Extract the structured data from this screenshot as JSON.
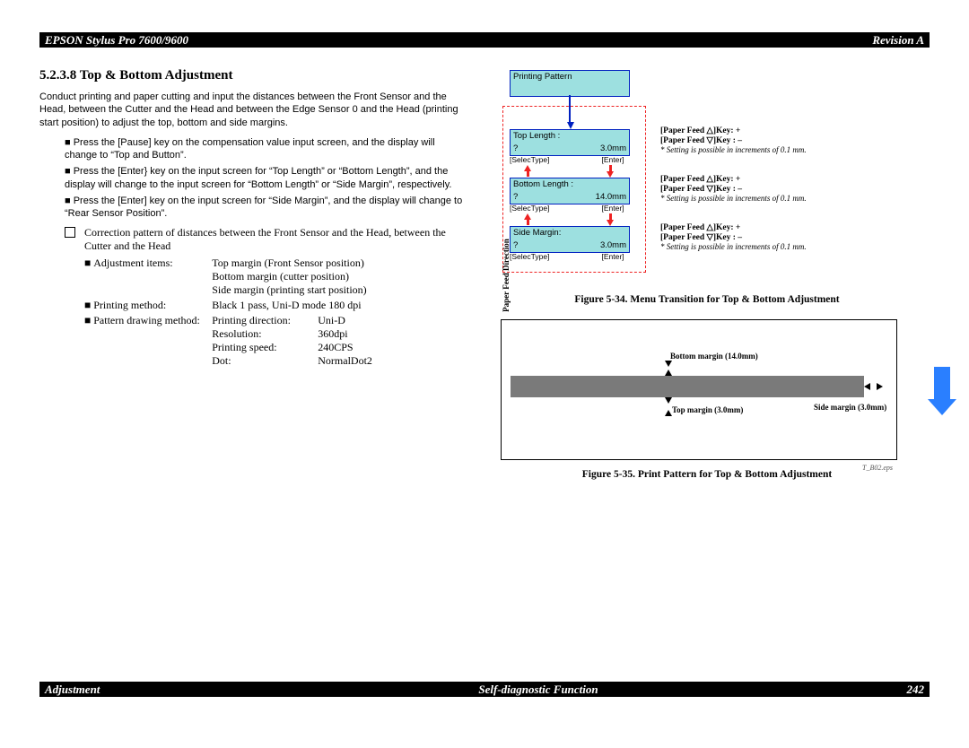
{
  "header": {
    "title": "EPSON Stylus Pro 7600/9600",
    "revision": "Revision A"
  },
  "footer": {
    "left": "Adjustment",
    "center": "Self-diagnostic Function",
    "page": "242"
  },
  "section": {
    "number_title": "5.2.3.8  Top & Bottom Adjustment",
    "intro": "Conduct printing and paper cutting and input the distances between the Front Sensor and the Head, between the Cutter and the Head and between the Edge Sensor 0 and the Head (printing start position) to adjust the top, bottom and side margins.",
    "bullets": [
      "Press the [Pause] key on the compensation value input screen, and the display will change to “Top and Button”.",
      "Press the [Enter} key on the input screen for “Top Length” or “Bottom Length”, and the display will change to the input screen for “Bottom Length” or “Side Margin”, respectively.",
      "Press the [Enter] key on the input screen for “Side Margin”, and the display will change to “Rear Sensor Position”."
    ],
    "check_item": "Correction pattern of distances between the Front Sensor and the Head, between the Cutter and the Head",
    "adj_items_label": "Adjustment items:",
    "adj_items": [
      "Top margin (Front Sensor position)",
      "Bottom margin (cutter position)",
      "Side margin (printing start position)"
    ],
    "print_method_label": "Printing method:",
    "print_method_value": "Black 1 pass, Uni-D mode 180 dpi",
    "pattern_label": "Pattern drawing method:",
    "pattern_rows": [
      {
        "k": "Printing direction:",
        "v": "Uni-D"
      },
      {
        "k": "Resolution:",
        "v": "360dpi"
      },
      {
        "k": "Printing speed:",
        "v": "240CPS"
      },
      {
        "k": "Dot:",
        "v": "NormalDot2"
      }
    ]
  },
  "diagram1": {
    "printing": "Printing Pattern",
    "top": {
      "title": "Top Length :",
      "q": "?",
      "val": "3.0mm"
    },
    "bottom": {
      "title": "Bottom Length :",
      "q": "?",
      "val": "14.0mm"
    },
    "side": {
      "title": "Side Margin:",
      "q": "?",
      "val": "3.0mm"
    },
    "selec": "[SelecType]",
    "enter": "[Enter]",
    "key_up": "[Paper Feed △]Key: +",
    "key_down": "[Paper Feed ▽]Key : –",
    "setting": "* Setting is possible in increments of 0.1 mm."
  },
  "figure34_caption": "Figure 5-34.  Menu Transition for Top & Bottom Adjustment",
  "diagram2": {
    "bottom_margin": "Bottom margin (14.0mm)",
    "top_margin": "Top margin (3.0mm)",
    "side_margin": "Side margin (3.0mm)",
    "paper_feed": "Paper Feed Direction",
    "eps": "T_B02.eps"
  },
  "figure35_caption": "Figure 5-35.  Print Pattern for Top & Bottom Adjustment"
}
